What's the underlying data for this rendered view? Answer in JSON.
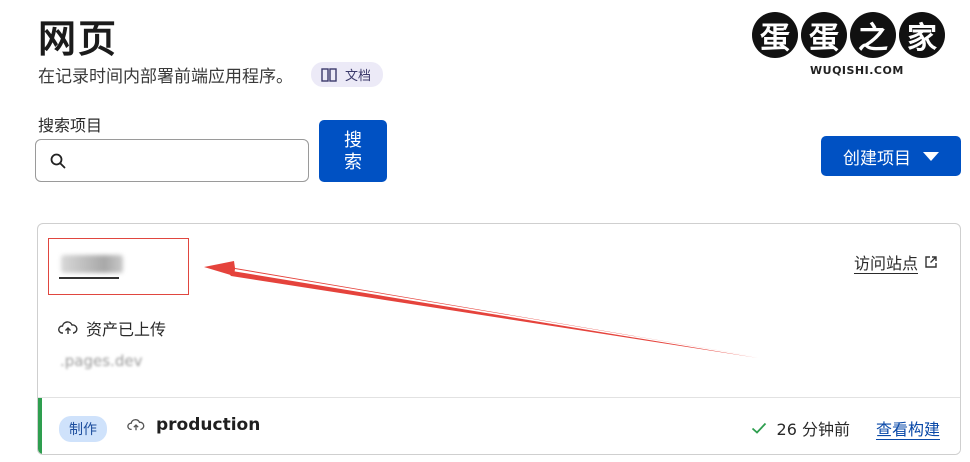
{
  "header": {
    "title": "网页",
    "subtitle": "在记录时间内部署前端应用程序。",
    "docs_label": "文档"
  },
  "logo": {
    "chars": [
      "蛋",
      "蛋",
      "之",
      "家"
    ],
    "sub": "WUQISHI.COM"
  },
  "search": {
    "label": "搜索项目",
    "value": "",
    "placeholder": "",
    "button_label": "搜索"
  },
  "create_button": {
    "label": "创建项目"
  },
  "project_card": {
    "visit_label": "访问站点",
    "assets_status": "资产已上传",
    "domain": ".pages.dev",
    "deployment": {
      "env_badge": "制作",
      "branch": "production",
      "time_ago": "26 分钟前",
      "view_build_label": "查看构建"
    }
  },
  "colors": {
    "primary": "#0051c3",
    "annotation": "#e0463f",
    "success": "#2e9e4f",
    "badge_bg": "#cfe2fb"
  }
}
